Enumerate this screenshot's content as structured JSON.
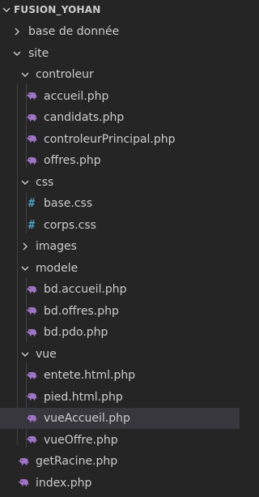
{
  "explorer": {
    "title": "FUSION_YOHAN",
    "items": [
      {
        "label": "base de donnée",
        "kind": "folder",
        "expanded": false,
        "depth": 1,
        "icon": "chevron-right-icon"
      },
      {
        "label": "site",
        "kind": "folder",
        "expanded": true,
        "depth": 1,
        "icon": "chevron-down-icon"
      },
      {
        "label": "controleur",
        "kind": "folder",
        "expanded": true,
        "depth": 2,
        "icon": "chevron-down-icon"
      },
      {
        "label": "accueil.php",
        "kind": "file",
        "depth": 3,
        "icon": "php-elephant-icon"
      },
      {
        "label": "candidats.php",
        "kind": "file",
        "depth": 3,
        "icon": "php-elephant-icon"
      },
      {
        "label": "controleurPrincipal.php",
        "kind": "file",
        "depth": 3,
        "icon": "php-elephant-icon"
      },
      {
        "label": "offres.php",
        "kind": "file",
        "depth": 3,
        "icon": "php-elephant-icon"
      },
      {
        "label": "css",
        "kind": "folder",
        "expanded": true,
        "depth": 2,
        "icon": "chevron-down-icon"
      },
      {
        "label": "base.css",
        "kind": "file",
        "depth": 3,
        "icon": "css-hash-icon"
      },
      {
        "label": "corps.css",
        "kind": "file",
        "depth": 3,
        "icon": "css-hash-icon"
      },
      {
        "label": "images",
        "kind": "folder",
        "expanded": false,
        "depth": 2,
        "icon": "chevron-right-icon"
      },
      {
        "label": "modele",
        "kind": "folder",
        "expanded": true,
        "depth": 2,
        "icon": "chevron-down-icon"
      },
      {
        "label": "bd.accueil.php",
        "kind": "file",
        "depth": 3,
        "icon": "php-elephant-icon"
      },
      {
        "label": "bd.offres.php",
        "kind": "file",
        "depth": 3,
        "icon": "php-elephant-icon"
      },
      {
        "label": "bd.pdo.php",
        "kind": "file",
        "depth": 3,
        "icon": "php-elephant-icon"
      },
      {
        "label": "vue",
        "kind": "folder",
        "expanded": true,
        "depth": 2,
        "icon": "chevron-down-icon"
      },
      {
        "label": "entete.html.php",
        "kind": "file",
        "depth": 3,
        "icon": "php-elephant-icon"
      },
      {
        "label": "pied.html.php",
        "kind": "file",
        "depth": 3,
        "icon": "php-elephant-icon"
      },
      {
        "label": "vueAccueil.php",
        "kind": "file",
        "depth": 3,
        "icon": "php-elephant-icon",
        "selected": true
      },
      {
        "label": "vueOffre.php",
        "kind": "file",
        "depth": 3,
        "icon": "php-elephant-icon"
      },
      {
        "label": "getRacine.php",
        "kind": "file",
        "depth": 2,
        "icon": "php-elephant-icon"
      },
      {
        "label": "index.php",
        "kind": "file",
        "depth": 2,
        "icon": "php-elephant-icon"
      }
    ]
  },
  "colors": {
    "background": "#252526",
    "text": "#cccccc",
    "selected_row": "#37373d",
    "php_icon": "#a074c4",
    "css_icon": "#519aba",
    "indent_guide": "#3f3f46"
  }
}
